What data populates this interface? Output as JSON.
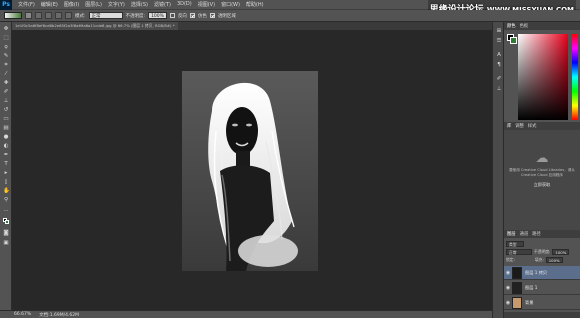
{
  "app": {
    "logo": "Ps"
  },
  "watermark": {
    "cn": "思缘设计论坛",
    "url": "WWW.MISSYUAN.COM"
  },
  "menu": [
    "文件(F)",
    "编辑(E)",
    "图像(I)",
    "图层(L)",
    "文字(Y)",
    "选择(S)",
    "滤镜(T)",
    "3D(D)",
    "视图(V)",
    "窗口(W)",
    "帮助(H)"
  ],
  "options": {
    "mode_label": "模式:",
    "mode_value": "正常",
    "opacity_label": "不透明度:",
    "opacity_value": "100%",
    "reverse_label": "反向",
    "dither_label": "仿色",
    "transparency_label": "透明区域"
  },
  "document": {
    "tab_title": "1e1f0c5a6f8ef6cd6b2e65f2a3f8a69a6a11cde8.jpg @ 66.7% (图层 1 拷贝, RGB/8#) *"
  },
  "status": {
    "zoom": "66.67%",
    "doc_size": "文档:1.69M/4.62M"
  },
  "color_panel": {
    "tabs": [
      "颜色",
      "色板"
    ],
    "fg_color": "#000000",
    "bg_color": "#2e7d32"
  },
  "libraries": {
    "tabs": [
      "库",
      "调整",
      "样式"
    ],
    "message": "要使用 Creative Cloud Libraries，请从 Creative Cloud 应用程序",
    "link": "立即获取"
  },
  "layers": {
    "tabs": [
      "图层",
      "通道",
      "路径"
    ],
    "kind_label": "类型",
    "blend_mode": "正常",
    "opacity_label": "不透明度:",
    "opacity_value": "100%",
    "lock_label": "锁定:",
    "fill_label": "填充:",
    "fill_value": "100%",
    "items": [
      {
        "name": "图层 1 拷贝",
        "selected": true
      },
      {
        "name": "图层 1",
        "selected": false
      },
      {
        "name": "背景",
        "selected": false
      }
    ]
  }
}
